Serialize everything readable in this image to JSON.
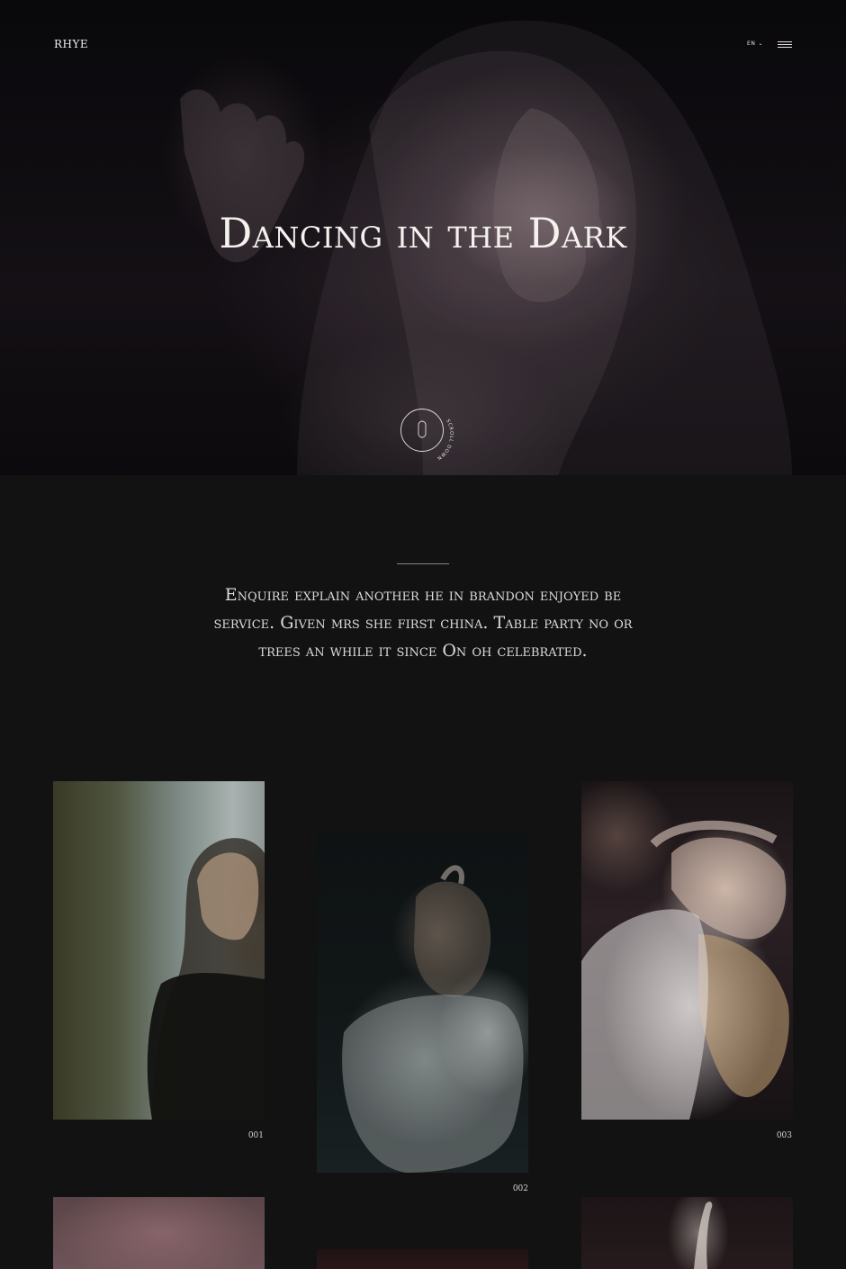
{
  "header": {
    "logo": "RHYE",
    "language": "EN",
    "menu_icon": "hamburger-icon",
    "lang_icon": "chevron-down-icon"
  },
  "hero": {
    "title": "Dancing in the Dark",
    "scroll_label": "SCROLL DOWN"
  },
  "intro": {
    "text": "Enquire explain another he in brandon enjoyed be service. Given mrs she first china. Table party no or trees an while it since On oh celebrated."
  },
  "gallery": {
    "items": [
      {
        "number": "001"
      },
      {
        "number": "002"
      },
      {
        "number": "003"
      }
    ]
  },
  "colors": {
    "background": "#121213",
    "text": "#e9e6e4"
  }
}
